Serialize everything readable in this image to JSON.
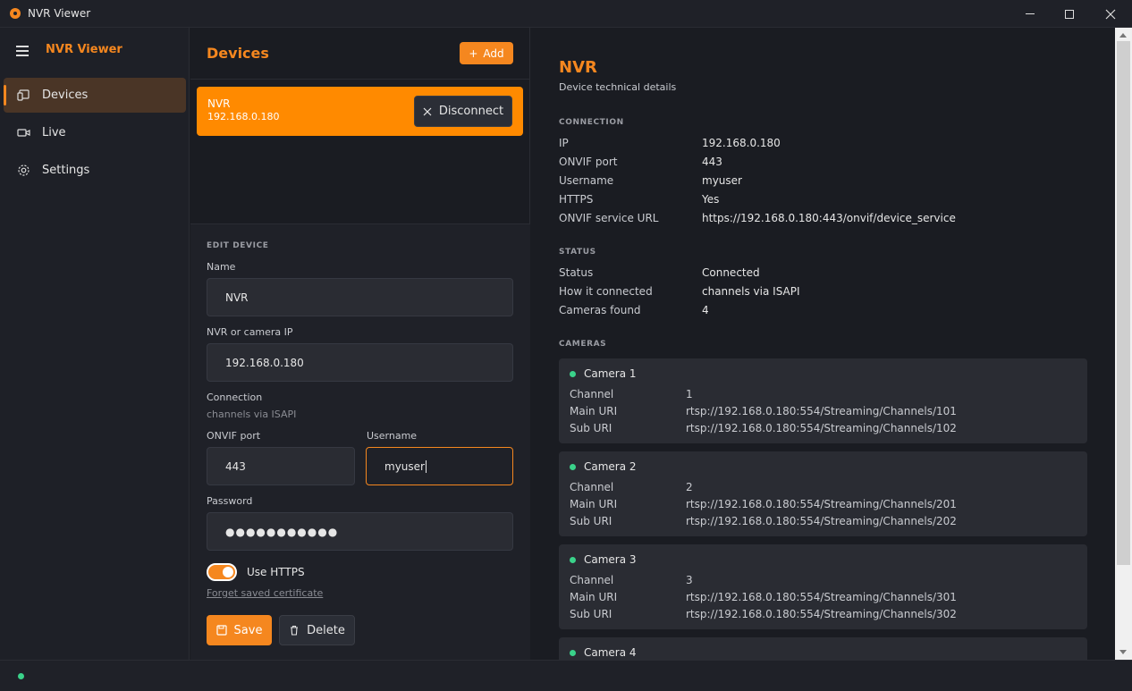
{
  "window": {
    "title": "NVR Viewer"
  },
  "sidebar": {
    "brand": "NVR Viewer",
    "items": [
      {
        "label": "Devices",
        "icon": "devices-icon",
        "active": true
      },
      {
        "label": "Live",
        "icon": "video-camera-icon",
        "active": false
      },
      {
        "label": "Settings",
        "icon": "gear-icon",
        "active": false
      }
    ]
  },
  "devices": {
    "title": "Devices",
    "add_label": "Add",
    "list": [
      {
        "name": "NVR",
        "ip": "192.168.0.180",
        "action_label": "Disconnect"
      }
    ]
  },
  "edit": {
    "section": "EDIT DEVICE",
    "name_label": "Name",
    "name_value": "NVR",
    "ip_label": "NVR or camera IP",
    "ip_value": "192.168.0.180",
    "connection_label": "Connection",
    "connection_value": "channels via ISAPI",
    "port_label": "ONVIF port",
    "port_value": "443",
    "username_label": "Username",
    "username_value": "myuser",
    "password_label": "Password",
    "password_value": "●●●●●●●●●●●",
    "https_label": "Use HTTPS",
    "https_on": true,
    "forget_label": "Forget saved certificate",
    "save_label": "Save",
    "delete_label": "Delete"
  },
  "details": {
    "title": "NVR",
    "subtitle": "Device technical details",
    "connection_section": "CONNECTION",
    "connection": [
      {
        "key": "IP",
        "value": "192.168.0.180"
      },
      {
        "key": "ONVIF port",
        "value": "443"
      },
      {
        "key": "Username",
        "value": "myuser"
      },
      {
        "key": "HTTPS",
        "value": "Yes"
      },
      {
        "key": "ONVIF service URL",
        "value": "https://192.168.0.180:443/onvif/device_service"
      }
    ],
    "status_section": "STATUS",
    "status": [
      {
        "key": "Status",
        "value": "Connected"
      },
      {
        "key": "How it connected",
        "value": "channels via ISAPI"
      },
      {
        "key": "Cameras found",
        "value": "4"
      }
    ],
    "cameras_section": "CAMERAS",
    "cameras": [
      {
        "name": "Camera 1",
        "channel_label": "Channel",
        "channel": "1",
        "main_label": "Main URI",
        "main": "rtsp://192.168.0.180:554/Streaming/Channels/101",
        "sub_label": "Sub URI",
        "sub": "rtsp://192.168.0.180:554/Streaming/Channels/102"
      },
      {
        "name": "Camera 2",
        "channel_label": "Channel",
        "channel": "2",
        "main_label": "Main URI",
        "main": "rtsp://192.168.0.180:554/Streaming/Channels/201",
        "sub_label": "Sub URI",
        "sub": "rtsp://192.168.0.180:554/Streaming/Channels/202"
      },
      {
        "name": "Camera 3",
        "channel_label": "Channel",
        "channel": "3",
        "main_label": "Main URI",
        "main": "rtsp://192.168.0.180:554/Streaming/Channels/301",
        "sub_label": "Sub URI",
        "sub": "rtsp://192.168.0.180:554/Streaming/Channels/302"
      },
      {
        "name": "Camera 4"
      }
    ]
  },
  "colors": {
    "accent": "#f5871f",
    "status_ok": "#3ad28a"
  }
}
